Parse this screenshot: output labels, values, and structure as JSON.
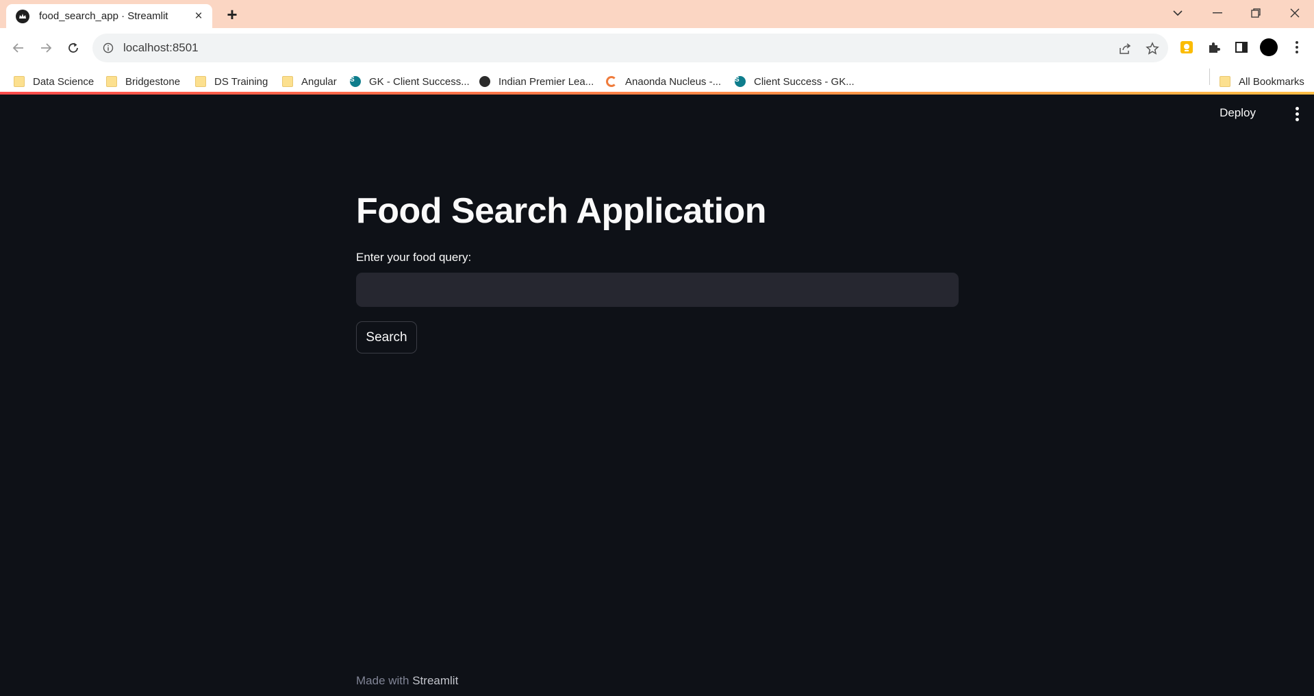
{
  "browser": {
    "tab_title": "food_search_app · Streamlit",
    "url": "localhost:8501",
    "bookmarks": [
      {
        "label": "Data Science",
        "icon": "folder-icon"
      },
      {
        "label": "Bridgestone",
        "icon": "folder-icon"
      },
      {
        "label": "DS Training",
        "icon": "folder-icon"
      },
      {
        "label": "Angular",
        "icon": "folder-icon"
      },
      {
        "label": "GK - Client Success...",
        "icon": "sharepoint-icon"
      },
      {
        "label": "Indian Premier Lea...",
        "icon": "globe-icon"
      },
      {
        "label": "Anaonda Nucleus -...",
        "icon": "anaconda-icon"
      },
      {
        "label": "Client Success - GK...",
        "icon": "sharepoint-icon"
      }
    ],
    "all_bookmarks": "All Bookmarks",
    "sharepoint_badge": "S"
  },
  "app": {
    "deploy_label": "Deploy",
    "title": "Food Search Application",
    "query_label": "Enter your food query:",
    "query_value": "",
    "search_label": "Search",
    "footer_prefix": "Made with",
    "footer_brand": "Streamlit"
  },
  "colors": {
    "background": "#0e1117",
    "input_bg": "#262730",
    "tabbar": "#fbd6c3",
    "accent_start": "#ff4b4b",
    "accent_end": "#ffbd45"
  }
}
